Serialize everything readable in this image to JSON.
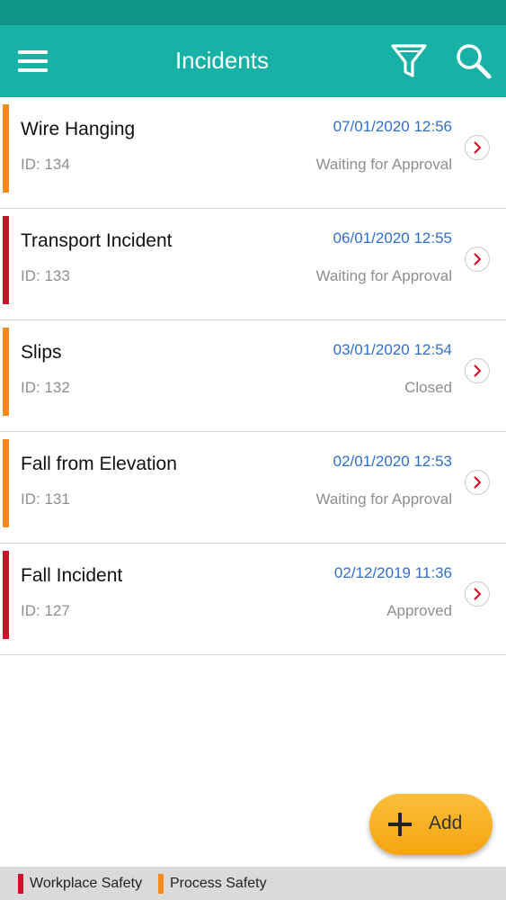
{
  "header": {
    "title": "Incidents"
  },
  "icons": {
    "menu": "menu-icon",
    "filter": "filter-icon",
    "search": "search-icon",
    "chevron": "chevron-right-icon",
    "add": "plus-icon"
  },
  "colors": {
    "status_bar": "#0e9488",
    "app_bar": "#17b1a5",
    "date_text": "#2f6fcc",
    "workplace_safety": "#d0112b",
    "process_safety": "#f28a1e",
    "chevron": "#d0112b",
    "fab": "#f7ac1c"
  },
  "incidents": [
    {
      "title": "Wire Hanging",
      "id_label": "ID: 134",
      "date": "07/01/2020 12:56",
      "status": "Waiting for Approval",
      "category": "process_safety"
    },
    {
      "title": "Transport Incident",
      "id_label": "ID: 133",
      "date": "06/01/2020 12:55",
      "status": "Waiting for Approval",
      "category": "workplace_safety"
    },
    {
      "title": "Slips",
      "id_label": "ID: 132",
      "date": "03/01/2020 12:54",
      "status": "Closed",
      "category": "process_safety"
    },
    {
      "title": "Fall from Elevation",
      "id_label": "ID: 131",
      "date": "02/01/2020 12:53",
      "status": "Waiting for Approval",
      "category": "process_safety"
    },
    {
      "title": "Fall Incident",
      "id_label": "ID: 127",
      "date": "02/12/2019 11:36",
      "status": "Approved",
      "category": "workplace_safety"
    }
  ],
  "fab": {
    "label": "Add"
  },
  "legend": [
    {
      "label": "Workplace Safety",
      "category": "workplace_safety"
    },
    {
      "label": "Process Safety",
      "category": "process_safety"
    }
  ]
}
